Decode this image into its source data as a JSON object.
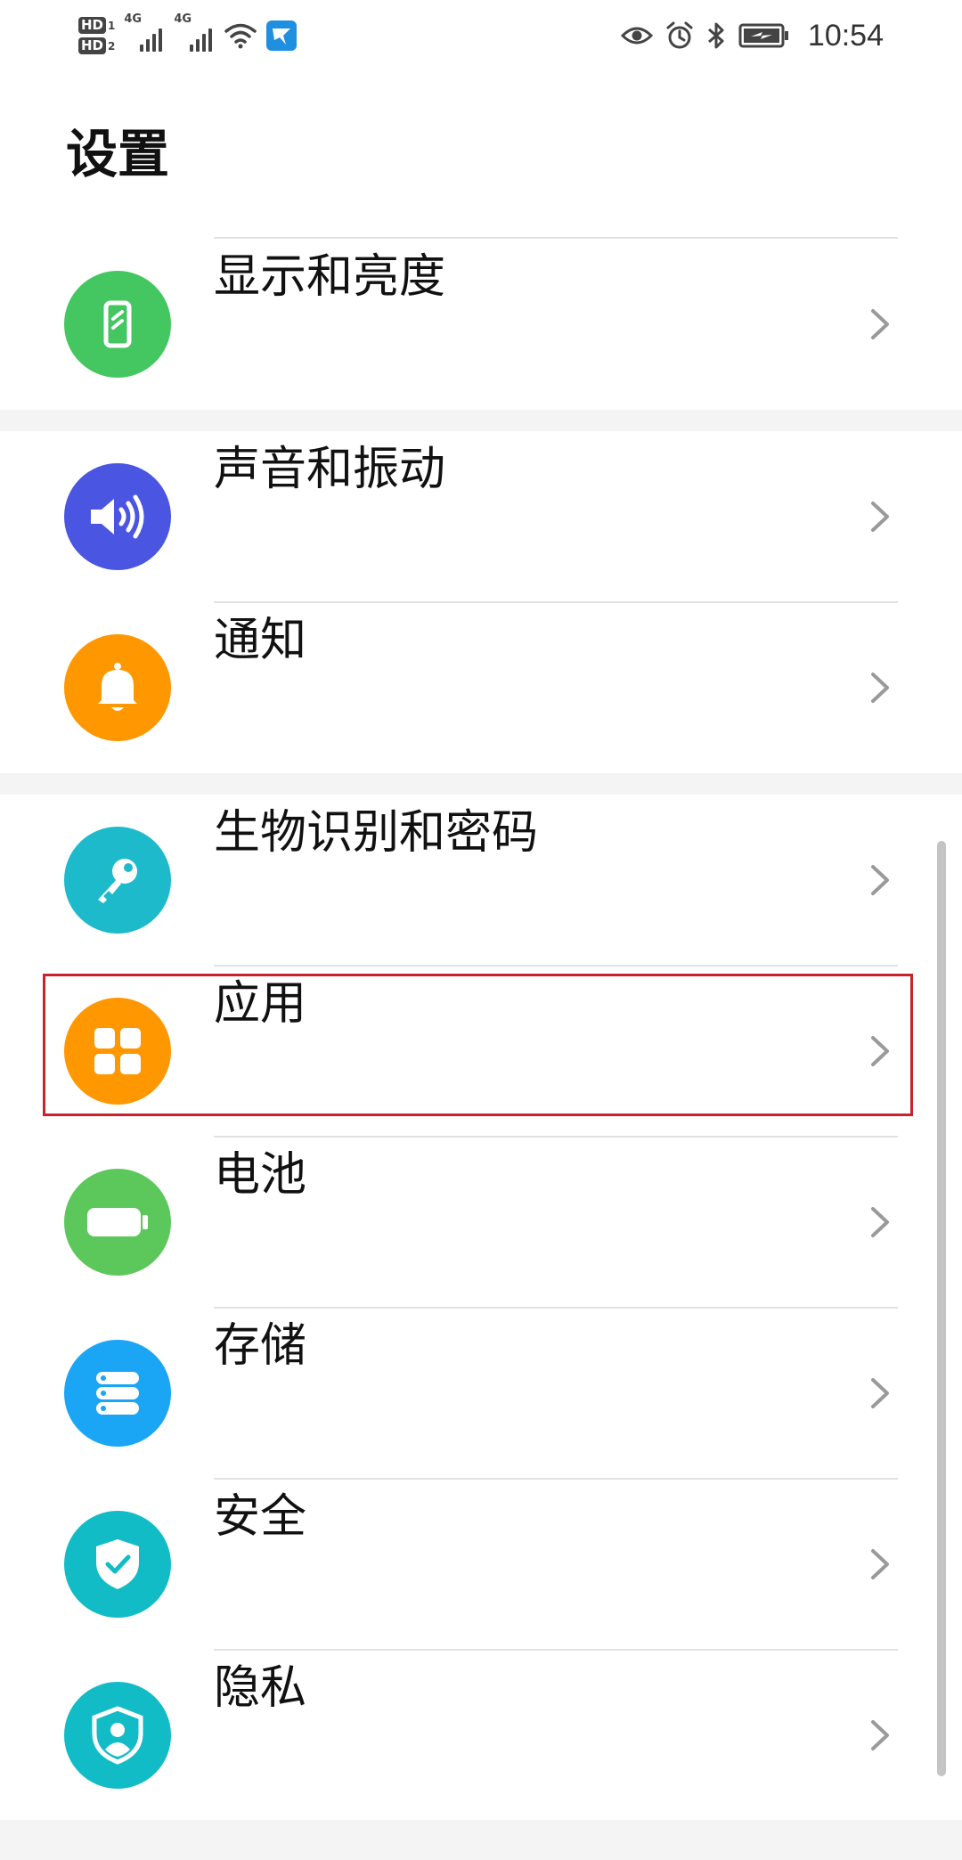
{
  "status_bar": {
    "hd1": "HD",
    "hd1_num": "1",
    "hd2": "HD",
    "hd2_num": "2",
    "network1": "4G",
    "network2": "4G",
    "time": "10:54",
    "icons": [
      "eye-comfort-icon",
      "alarm-icon",
      "bluetooth-icon",
      "battery-charging-icon"
    ],
    "left_icons": [
      "wifi-icon",
      "app-notification-icon"
    ]
  },
  "page": {
    "title": "设置"
  },
  "colors": {
    "display": "#44c761",
    "sound": "#4a56e2",
    "notification": "#ff9800",
    "biometrics": "#1dbacb",
    "apps": "#ff9800",
    "battery": "#5cc85b",
    "storage": "#1aa5f5",
    "security": "#12bcc6",
    "privacy": "#12bcc6",
    "highlight": "#c8232c"
  },
  "settings": {
    "display": {
      "label": "显示和亮度",
      "icon": "phone-display-icon"
    },
    "sound": {
      "label": "声音和振动",
      "icon": "speaker-icon"
    },
    "notification": {
      "label": "通知",
      "icon": "bell-icon"
    },
    "biometrics": {
      "label": "生物识别和密码",
      "icon": "key-icon"
    },
    "apps": {
      "label": "应用",
      "icon": "apps-grid-icon"
    },
    "battery": {
      "label": "电池",
      "icon": "battery-icon"
    },
    "storage": {
      "label": "存储",
      "icon": "storage-icon"
    },
    "security": {
      "label": "安全",
      "icon": "shield-check-icon"
    },
    "privacy": {
      "label": "隐私",
      "icon": "privacy-shield-icon"
    }
  }
}
